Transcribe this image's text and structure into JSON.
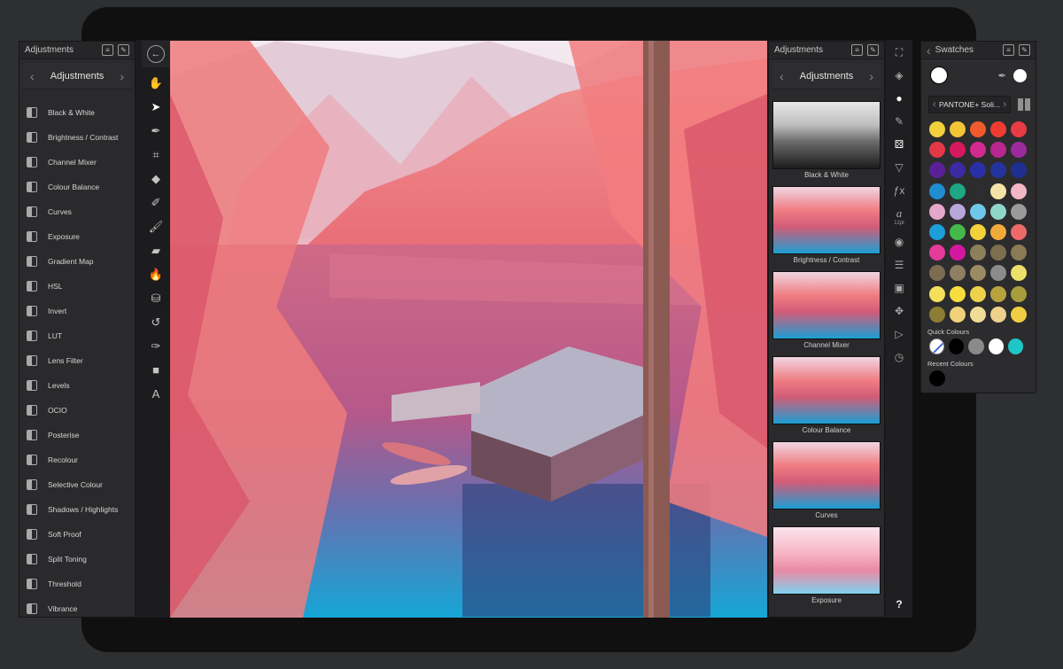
{
  "left_panel": {
    "header_title": "Adjustments",
    "nav_title": "Adjustments",
    "items": [
      {
        "label": "Black & White",
        "icon": "black-white-icon"
      },
      {
        "label": "Brightness / Contrast",
        "icon": "brightness-icon"
      },
      {
        "label": "Channel Mixer",
        "icon": "channel-mixer-icon"
      },
      {
        "label": "Colour Balance",
        "icon": "colour-balance-icon"
      },
      {
        "label": "Curves",
        "icon": "curves-icon"
      },
      {
        "label": "Exposure",
        "icon": "exposure-icon"
      },
      {
        "label": "Gradient Map",
        "icon": "gradient-map-icon"
      },
      {
        "label": "HSL",
        "icon": "hsl-icon"
      },
      {
        "label": "Invert",
        "icon": "invert-icon"
      },
      {
        "label": "LUT",
        "icon": "lut-icon"
      },
      {
        "label": "Lens Filter",
        "icon": "lens-filter-icon"
      },
      {
        "label": "Levels",
        "icon": "levels-icon"
      },
      {
        "label": "OCIO",
        "icon": "ocio-icon"
      },
      {
        "label": "Posterise",
        "icon": "posterise-icon"
      },
      {
        "label": "Recolour",
        "icon": "recolour-icon"
      },
      {
        "label": "Selective Colour",
        "icon": "selective-colour-icon"
      },
      {
        "label": "Shadows / Highlights",
        "icon": "shadows-highlights-icon"
      },
      {
        "label": "Soft Proof",
        "icon": "soft-proof-icon"
      },
      {
        "label": "Split Toning",
        "icon": "split-toning-icon"
      },
      {
        "label": "Threshold",
        "icon": "threshold-icon"
      },
      {
        "label": "Vibrance",
        "icon": "vibrance-icon"
      }
    ]
  },
  "right_panel": {
    "header_title": "Adjustments",
    "nav_title": "Adjustments",
    "previews": [
      {
        "label": "Black & White",
        "mode": "bw"
      },
      {
        "label": "Brightness / Contrast",
        "mode": "color"
      },
      {
        "label": "Channel Mixer",
        "mode": "color"
      },
      {
        "label": "Colour Balance",
        "mode": "color"
      },
      {
        "label": "Curves",
        "mode": "color"
      },
      {
        "label": "Exposure",
        "mode": "bright"
      }
    ]
  },
  "studio": {
    "font_size_label": "12pt",
    "help_label": "?"
  },
  "swatches": {
    "header_title": "Swatches",
    "palette_name": "PANTONE+ Soli...",
    "quick_label": "Quick Colours",
    "recent_label": "Recent Colours",
    "colors": [
      "#f2d03b",
      "#f4c437",
      "#f05a2c",
      "#ef3c33",
      "#e93b44",
      "#e23848",
      "#d8185d",
      "#d22a8f",
      "#b9268f",
      "#9d2a9d",
      "#5b1f98",
      "#3b2aa0",
      "#2a2fa8",
      "#23349f",
      "#1f2f91",
      "#1f8dd0",
      "#1ea783",
      "#2d2d2f",
      "#f4e3a6",
      "#f3b6c7",
      "#e6a6cc",
      "#b9a6d9",
      "#6ec7e8",
      "#8fd6c9",
      "#9a9a9a",
      "#1c9fd8",
      "#46b84a",
      "#f3d13c",
      "#f0a93b",
      "#ee6a69",
      "#e43b9b",
      "#d5179f",
      "#8d7f5a",
      "#7c6f4d",
      "#8a7b55",
      "#7e6c52",
      "#8e7e62",
      "#9c8a63",
      "#8c8c8c",
      "#ecdf6a",
      "#f4df58",
      "#f7dd3f",
      "#efd24c",
      "#b8a43f",
      "#a89d3c",
      "#8d7c33",
      "#efd27a",
      "#f0dc96",
      "#ecd08b",
      "#f0cd43"
    ],
    "quick_colors": [
      "none",
      "#000000",
      "#8a8a8a",
      "#ffffff",
      "#1ec7c7"
    ],
    "recent_colors": [
      "#000000"
    ]
  }
}
